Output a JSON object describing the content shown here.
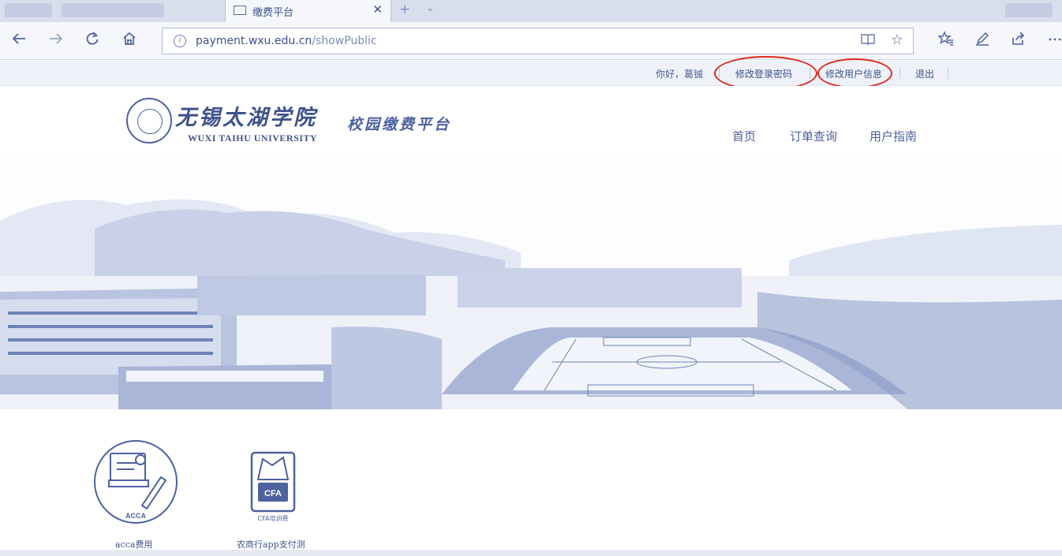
{
  "browser": {
    "tab_title": "缴费平台",
    "tab_close": "✕",
    "new_tab": "+",
    "tab_list": "⌄",
    "url_host": "payment.wxu.edu.cn",
    "url_path": "/showPublic",
    "icons": [
      "back-icon",
      "forward-icon",
      "refresh-icon",
      "home-icon",
      "info-icon",
      "reading-view-icon",
      "favorite-star-icon",
      "favorites-icon",
      "notes-icon",
      "share-icon",
      "more-icon"
    ]
  },
  "topbar": {
    "greeting": "你好，葛铖",
    "change_password": "修改登录密码",
    "edit_user_info": "修改用户信息",
    "logout": "退出"
  },
  "header": {
    "university_cn": "无锡太湖学院",
    "university_en": "WUXI TAIHU UNIVERSITY",
    "platform_name": "校园缴费平台",
    "nav": {
      "home": "首页",
      "order_query": "订单查询",
      "user_guide": "用户指南"
    }
  },
  "services": [
    {
      "label": "acca费用",
      "badge": "ACCA"
    },
    {
      "label": "农商行app支付测",
      "badge": "CFA",
      "caption": "CFA培训费"
    }
  ],
  "colors": {
    "tint": "#4a5f99",
    "annotation_circle": "#e0261b"
  }
}
